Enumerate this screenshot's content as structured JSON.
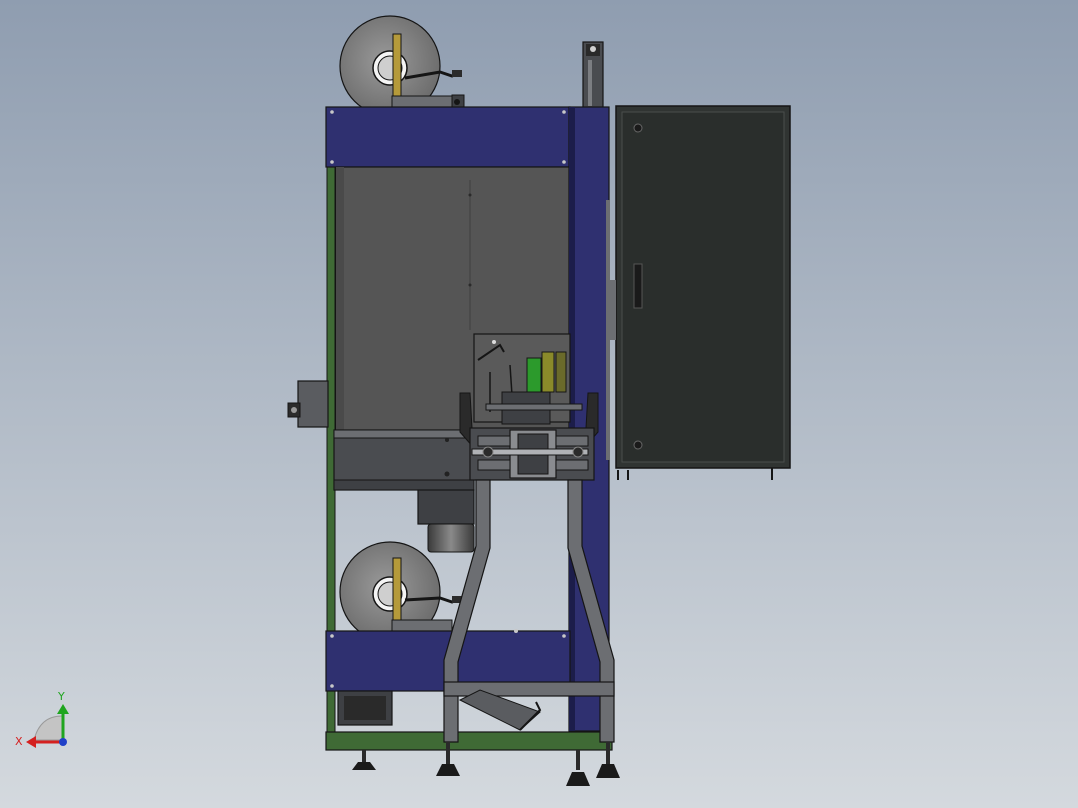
{
  "view": {
    "background_top": "#8f9db0",
    "background_bottom": "#d4d9de"
  },
  "colors": {
    "frame_navy": "#2f3070",
    "frame_navy_dark": "#1c1d4a",
    "frame_green": "#3f6a35",
    "panel_gray": "#555555",
    "cabinet_dark": "#303432",
    "steel": "#6c6e72",
    "steel_dark": "#3e4044",
    "roll_gray": "#7d7d7d",
    "roll_core": "#b59a3a",
    "accent_green": "#2c9a2c",
    "accent_olive": "#8a8a2a",
    "outline": "#151515"
  },
  "triad": {
    "x_label": "X",
    "y_label": "Y",
    "x_color": "#d42020",
    "y_color": "#1fa51f",
    "z_color": "#2040c8"
  }
}
